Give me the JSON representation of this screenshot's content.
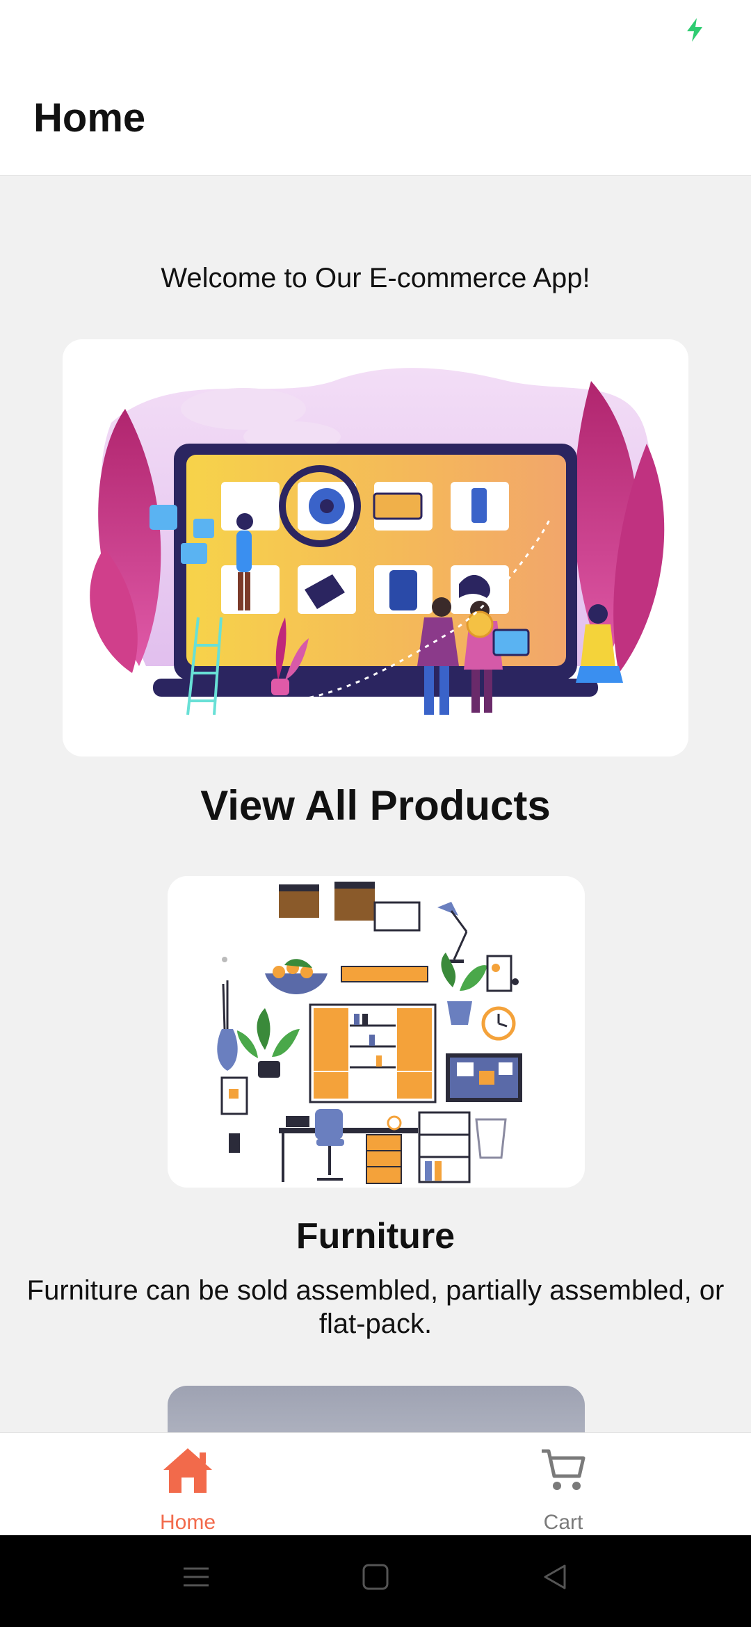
{
  "status_bar": {
    "icon": "charging-bolt-icon",
    "accent": "#2ecc71"
  },
  "app_bar": {
    "title": "Home"
  },
  "welcome_text": "Welcome to Our E-commerce App!",
  "hero": {
    "image": "ecommerce-illustration"
  },
  "section": {
    "title": "View All Products"
  },
  "categories": [
    {
      "title": "Furniture",
      "description": "Furniture can be sold assembled, partially assembled, or flat-pack.",
      "image": "furniture-illustration"
    }
  ],
  "bottom_nav": {
    "items": [
      {
        "label": "Home",
        "icon": "home-icon",
        "active": true,
        "color": "#f26a4b"
      },
      {
        "label": "Cart",
        "icon": "cart-icon",
        "active": false,
        "color": "#7a7a7a"
      }
    ]
  },
  "system_nav": {
    "buttons": [
      "menu",
      "home",
      "back"
    ]
  }
}
